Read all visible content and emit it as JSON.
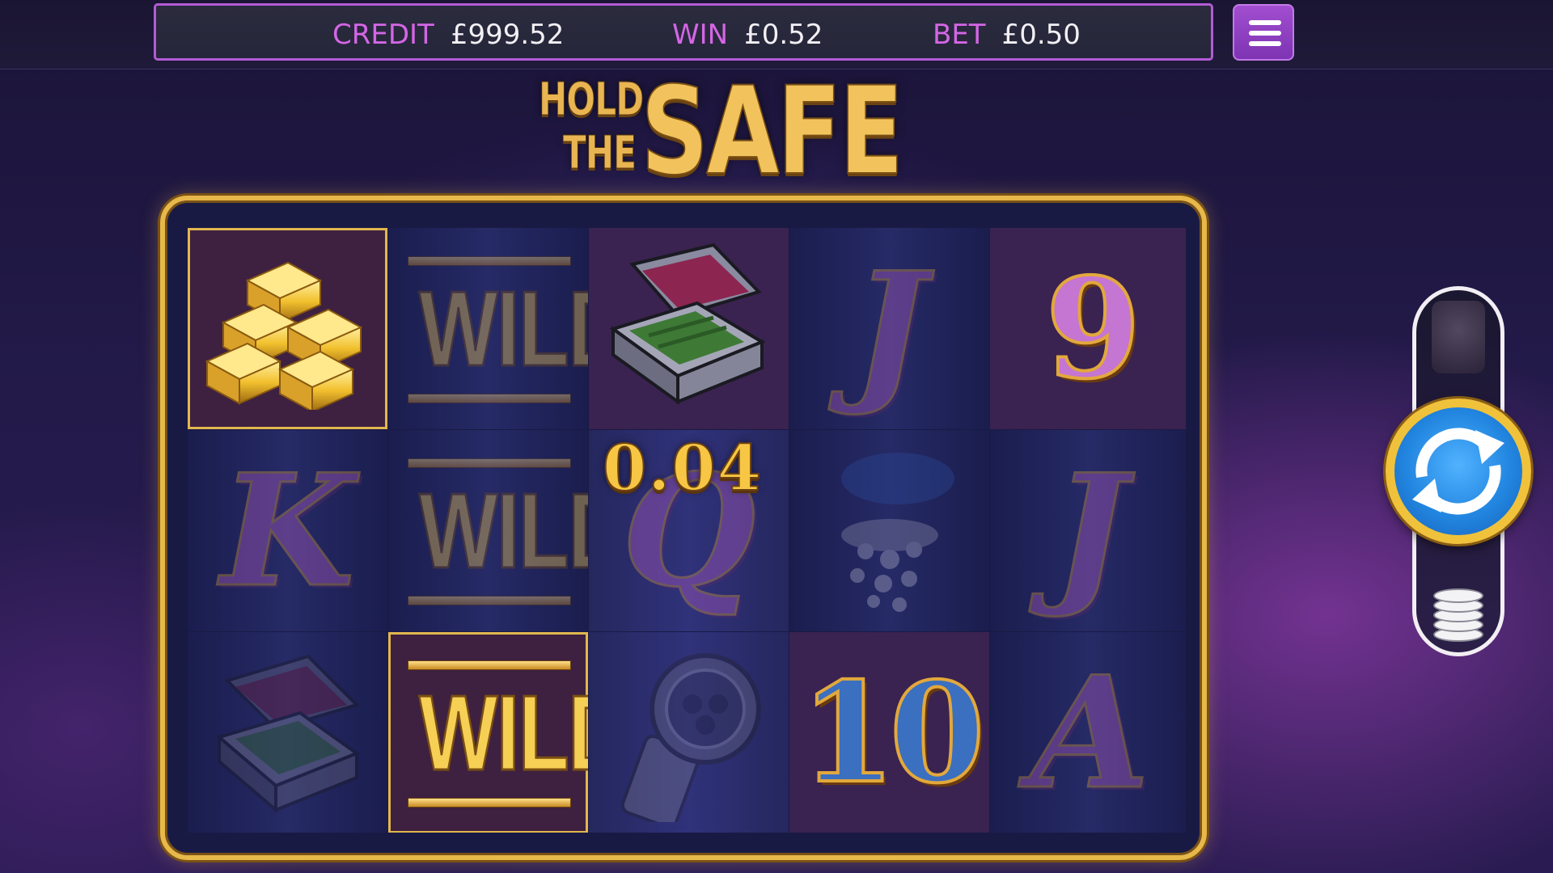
{
  "header": {
    "credit_label": "CREDIT",
    "credit_value": "£999.52",
    "win_label": "WIN",
    "win_value": "£0.52",
    "bet_label": "BET",
    "bet_value": "£0.50",
    "menu_icon": "hamburger-menu-icon"
  },
  "logo": {
    "line1": "HOLD",
    "line2": "THE",
    "big": "SAFE"
  },
  "reels": {
    "win_amount": "0.04",
    "symbols": [
      {
        "reel": 1,
        "row": 1,
        "symbol": "gold-bars-icon",
        "highlighted": true
      },
      {
        "reel": 1,
        "row": 2,
        "symbol": "K"
      },
      {
        "reel": 1,
        "row": 3,
        "symbol": "cash-briefcase-icon"
      },
      {
        "reel": 2,
        "row": 1,
        "symbol": "WILD"
      },
      {
        "reel": 2,
        "row": 2,
        "symbol": "WILD"
      },
      {
        "reel": 2,
        "row": 3,
        "symbol": "WILD",
        "highlighted": true
      },
      {
        "reel": 3,
        "row": 1,
        "symbol": "cash-briefcase-icon"
      },
      {
        "reel": 3,
        "row": 2,
        "symbol": "Q"
      },
      {
        "reel": 3,
        "row": 3,
        "symbol": "watch-icon"
      },
      {
        "reel": 4,
        "row": 1,
        "symbol": "J"
      },
      {
        "reel": 4,
        "row": 2,
        "symbol": "diamonds-pouch-icon"
      },
      {
        "reel": 4,
        "row": 3,
        "symbol": "10"
      },
      {
        "reel": 5,
        "row": 1,
        "symbol": "9"
      },
      {
        "reel": 5,
        "row": 2,
        "symbol": "J"
      },
      {
        "reel": 5,
        "row": 3,
        "symbol": "A"
      }
    ],
    "labels": {
      "k": "K",
      "q": "Q",
      "j": "J",
      "a": "A",
      "nine": "9",
      "ten": "10",
      "wild": "WILD"
    }
  },
  "controls": {
    "spin_icon": "spin-arrows-icon",
    "stake_icon": "coin-stack-icon",
    "autoplay_icon": "autoplay-slot-icon"
  },
  "colors": {
    "label_pink": "#d466e6",
    "gold": "#e7b84a",
    "spin_blue": "#2286e0",
    "menu_purple": "#a24ed0"
  }
}
